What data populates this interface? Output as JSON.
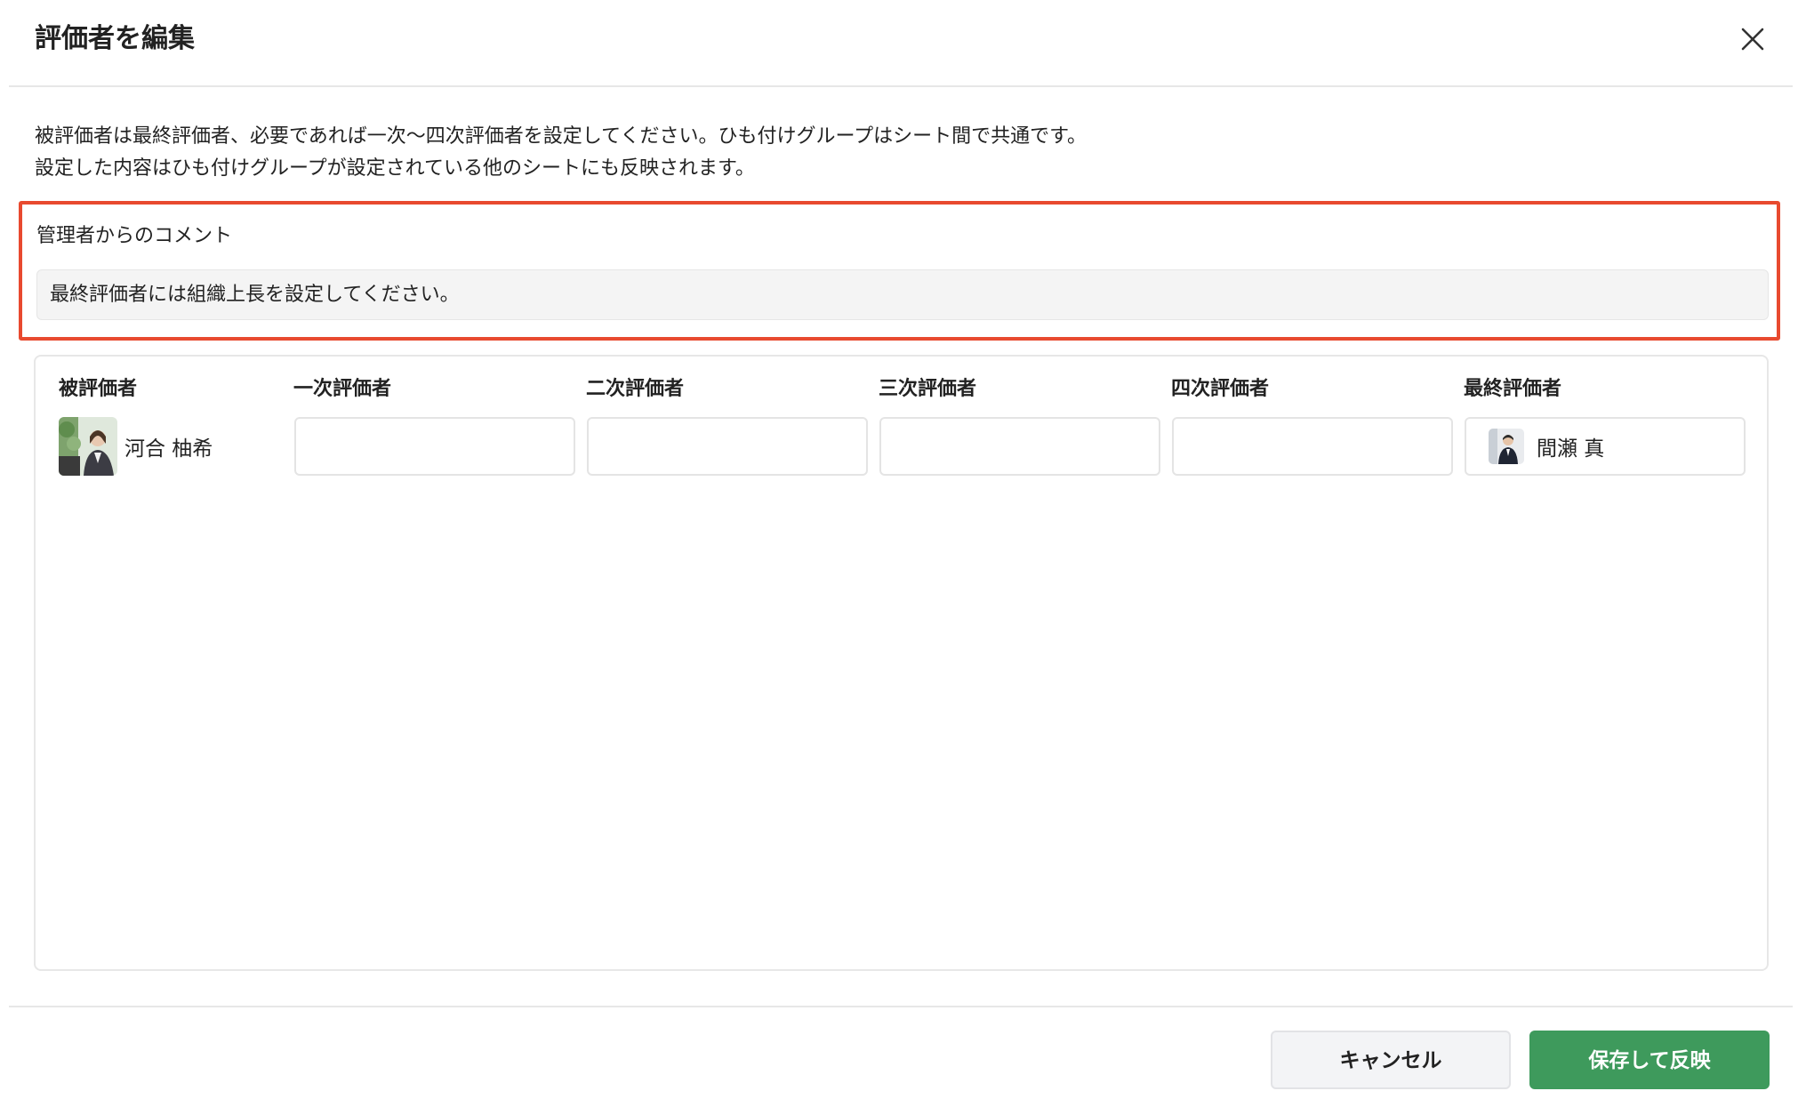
{
  "dialog": {
    "title": "評価者を編集",
    "close_icon": "close-icon"
  },
  "description": {
    "line1": "被評価者は最終評価者、必要であれば一次〜四次評価者を設定してください。ひも付けグループはシート間で共通です。",
    "line2": "設定した内容はひも付けグループが設定されている他のシートにも反映されます。"
  },
  "admin_comment": {
    "label": "管理者からのコメント",
    "value": "最終評価者には組織上長を設定してください。",
    "highlight_color": "#e84a2f"
  },
  "evaluators": {
    "headers": {
      "evaluatee": "被評価者",
      "first": "一次評価者",
      "second": "二次評価者",
      "third": "三次評価者",
      "fourth": "四次評価者",
      "final": "最終評価者"
    },
    "evaluatee": {
      "name": "河合 柚希",
      "avatar": "user-avatar"
    },
    "first": {
      "name": ""
    },
    "second": {
      "name": ""
    },
    "third": {
      "name": ""
    },
    "fourth": {
      "name": ""
    },
    "final": {
      "name": "間瀬 真",
      "avatar": "user-avatar"
    }
  },
  "footer": {
    "cancel_label": "キャンセル",
    "save_label": "保存して反映",
    "save_color": "#3e9a5c"
  }
}
